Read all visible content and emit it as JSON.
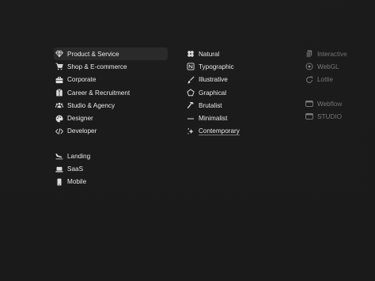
{
  "column_left": {
    "group1": [
      {
        "label": "Product & Service",
        "icon": "gem-icon"
      },
      {
        "label": "Shop & E-commerce",
        "icon": "cart-icon"
      },
      {
        "label": "Corporate",
        "icon": "briefcase-icon"
      },
      {
        "label": "Career & Recruitment",
        "icon": "suit-icon"
      },
      {
        "label": "Studio & Agency",
        "icon": "people-icon"
      },
      {
        "label": "Designer",
        "icon": "palette-icon"
      },
      {
        "label": "Developer",
        "icon": "code-icon"
      }
    ],
    "group2": [
      {
        "label": "Landing",
        "icon": "plane-landing-icon"
      },
      {
        "label": "SaaS",
        "icon": "laptop-icon"
      },
      {
        "label": "Mobile",
        "icon": "phone-icon"
      }
    ]
  },
  "column_middle": [
    {
      "label": "Natural",
      "icon": "clover-icon"
    },
    {
      "label": "Typographic",
      "icon": "notion-icon"
    },
    {
      "label": "Illustrative",
      "icon": "brush-icon"
    },
    {
      "label": "Graphical",
      "icon": "pentagon-icon"
    },
    {
      "label": "Brutalist",
      "icon": "hammer-icon"
    },
    {
      "label": "Minimalist",
      "icon": "minus-icon"
    },
    {
      "label": "Contemporary",
      "icon": "sparkles-icon"
    }
  ],
  "column_right": {
    "group1": [
      {
        "label": "Interactive",
        "icon": "layers-icon"
      },
      {
        "label": "WebGL",
        "icon": "globe-icon"
      },
      {
        "label": "Lottie",
        "icon": "refresh-icon"
      }
    ],
    "group2": [
      {
        "label": "Webflow",
        "icon": "window-icon"
      },
      {
        "label": "STUDIO",
        "icon": "window-icon"
      }
    ]
  },
  "colors": {
    "background": "#1a1a1a",
    "text": "#e9e9e9",
    "active_bg": "#2a2a2a"
  }
}
